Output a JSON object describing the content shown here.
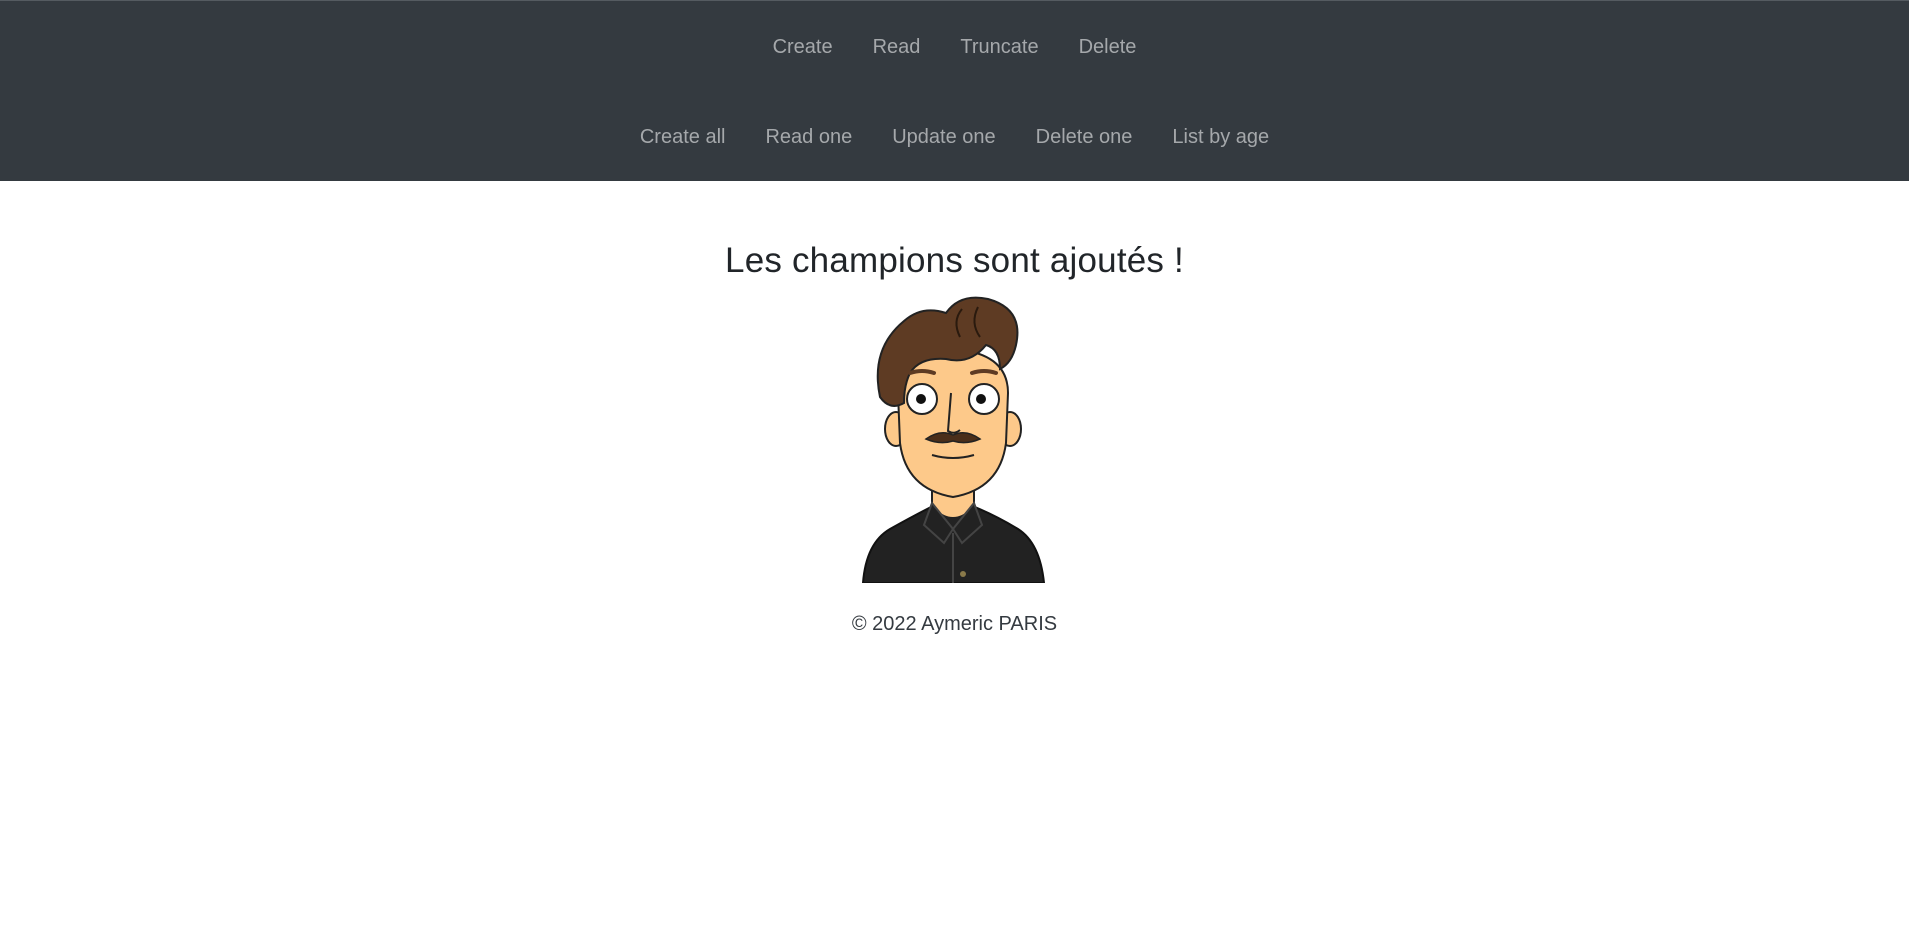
{
  "nav": {
    "row1": [
      "Create",
      "Read",
      "Truncate",
      "Delete"
    ],
    "row2": [
      "Create all",
      "Read one",
      "Update one",
      "Delete one",
      "List by age"
    ]
  },
  "main": {
    "title": "Les champions sont ajoutés !",
    "avatar_icon": "cartoon-man-avatar"
  },
  "footer": {
    "text": "© 2022 Aymeric PARIS"
  },
  "colors": {
    "navbar_bg": "#343a40",
    "nav_link": "#a5a8ab",
    "hair": "#5e3b23",
    "skin": "#fdc98a",
    "shirt": "#222222"
  }
}
